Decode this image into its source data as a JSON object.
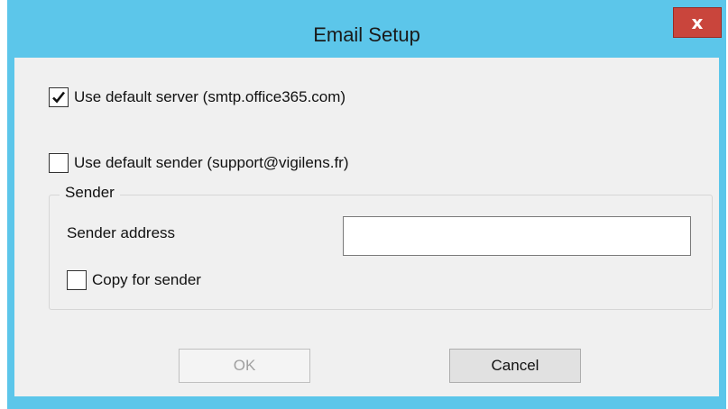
{
  "window": {
    "title": "Email Setup",
    "close_label": "x"
  },
  "options": {
    "default_server": {
      "label": "Use default server (smtp.office365.com)",
      "checked": true
    },
    "default_sender": {
      "label": "Use default sender (support@vigilens.fr)",
      "checked": false
    }
  },
  "sender_group": {
    "legend": "Sender",
    "address_label": "Sender address",
    "address_value": "",
    "copy": {
      "label": "Copy for sender",
      "checked": false
    }
  },
  "buttons": {
    "ok_label": "OK",
    "ok_enabled": false,
    "cancel_label": "Cancel"
  },
  "colors": {
    "titlebar": "#5cc6ea",
    "close_button": "#c9453c",
    "client_background": "#f0f0f0"
  },
  "icons": {
    "check": "checkmark-icon",
    "close": "close-icon"
  }
}
